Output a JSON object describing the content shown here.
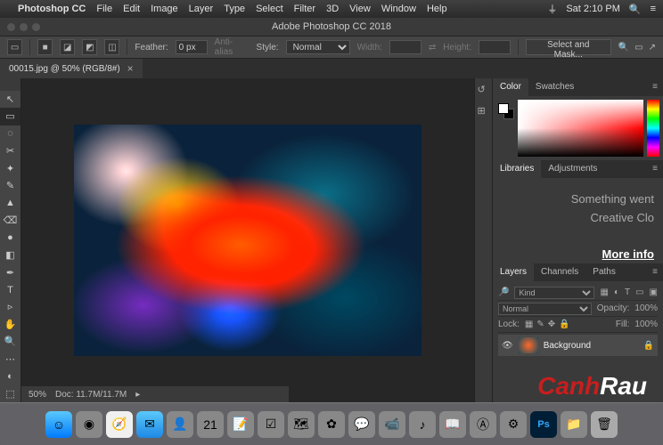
{
  "menubar": {
    "app": "Photoshop CC",
    "items": [
      "File",
      "Edit",
      "Image",
      "Layer",
      "Type",
      "Select",
      "Filter",
      "3D",
      "View",
      "Window",
      "Help"
    ],
    "clock": "Sat 2:10 PM"
  },
  "titlebar": {
    "title": "Adobe Photoshop CC 2018"
  },
  "options": {
    "feather_label": "Feather:",
    "feather_value": "0 px",
    "antialias": "Anti-alias",
    "style_label": "Style:",
    "style_value": "Normal",
    "width_label": "Width:",
    "height_label": "Height:",
    "mask_btn": "Select and Mask..."
  },
  "doc": {
    "tab_title": "00015.jpg @ 50% (RGB/8#)",
    "close": "×"
  },
  "tools": [
    "↖",
    "▭",
    "◌",
    "✂",
    "✦",
    "✎",
    "▲",
    "⌫",
    "●",
    "◧",
    "✒",
    "T",
    "▹",
    "✋",
    "🔍",
    "⋯",
    "◐",
    "⬚"
  ],
  "color_panel": {
    "tab1": "Color",
    "tab2": "Swatches"
  },
  "lib_panel": {
    "tab1": "Libraries",
    "tab2": "Adjustments",
    "line1": "Something went",
    "line2": "Creative Clo",
    "more": "More info"
  },
  "layers_panel": {
    "tab1": "Layers",
    "tab2": "Channels",
    "tab3": "Paths",
    "kind": "Kind",
    "blend": "Normal",
    "opacity_label": "Opacity:",
    "opacity_value": "100%",
    "lock_label": "Lock:",
    "fill_label": "Fill:",
    "fill_value": "100%",
    "layer_name": "Background"
  },
  "status": {
    "zoom": "50%",
    "doc": "Doc: 11.7M/11.7M"
  },
  "dock": {
    "items": [
      {
        "name": "finder",
        "cls": "finder",
        "glyph": "☺"
      },
      {
        "name": "launchpad",
        "cls": "generic",
        "glyph": "◉"
      },
      {
        "name": "safari",
        "cls": "safari",
        "glyph": "🧭"
      },
      {
        "name": "mail",
        "cls": "mail",
        "glyph": "✉"
      },
      {
        "name": "contacts",
        "cls": "generic",
        "glyph": "👤"
      },
      {
        "name": "calendar",
        "cls": "generic",
        "glyph": "21"
      },
      {
        "name": "notes",
        "cls": "generic",
        "glyph": "📝"
      },
      {
        "name": "reminders",
        "cls": "generic",
        "glyph": "☑"
      },
      {
        "name": "maps",
        "cls": "generic",
        "glyph": "🗺"
      },
      {
        "name": "photos",
        "cls": "generic",
        "glyph": "✿"
      },
      {
        "name": "messages",
        "cls": "generic",
        "glyph": "💬"
      },
      {
        "name": "facetime",
        "cls": "generic",
        "glyph": "📹"
      },
      {
        "name": "itunes",
        "cls": "generic",
        "glyph": "♪"
      },
      {
        "name": "ibooks",
        "cls": "generic",
        "glyph": "📖"
      },
      {
        "name": "appstore",
        "cls": "generic",
        "glyph": "Ⓐ"
      },
      {
        "name": "preferences",
        "cls": "generic",
        "glyph": "⚙"
      },
      {
        "name": "photoshop",
        "cls": "ps",
        "glyph": "Ps"
      },
      {
        "name": "folder",
        "cls": "generic",
        "glyph": "📁"
      },
      {
        "name": "trash",
        "cls": "trash",
        "glyph": "🗑"
      }
    ]
  },
  "watermark": {
    "p1": "Canh",
    "p2": "Rau"
  }
}
